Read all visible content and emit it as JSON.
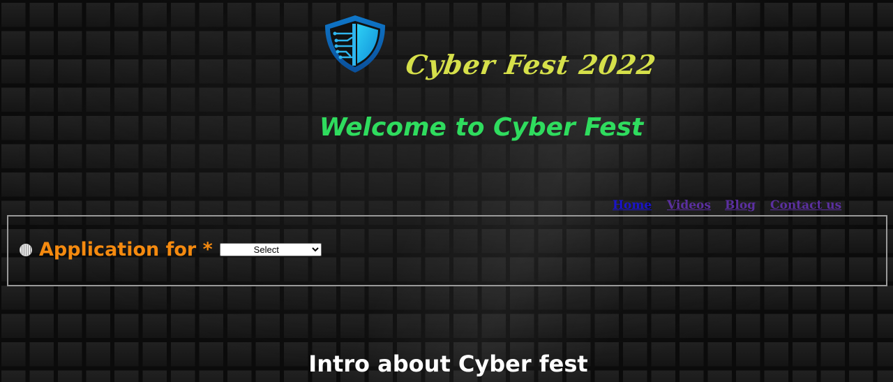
{
  "header": {
    "brand_title": "Cyber Fest 2022",
    "welcome_heading": "Welcome to Cyber Fest"
  },
  "nav": {
    "items": [
      {
        "label": "Home"
      },
      {
        "label": "Videos"
      },
      {
        "label": "Blog"
      },
      {
        "label": "Contact us"
      }
    ]
  },
  "application": {
    "label": "Application for *",
    "select_value": "Select"
  },
  "intro": {
    "heading": "Intro about Cyber fest"
  },
  "icons": {
    "logo": "shield-circuit-icon",
    "bullet": "disc-bullet-icon"
  },
  "colors": {
    "brand": "#d6e04a",
    "welcome": "#2fdc5e",
    "application_label": "#f58a0f",
    "link": "#1a14c9",
    "link_visited": "#5b2fa0"
  }
}
